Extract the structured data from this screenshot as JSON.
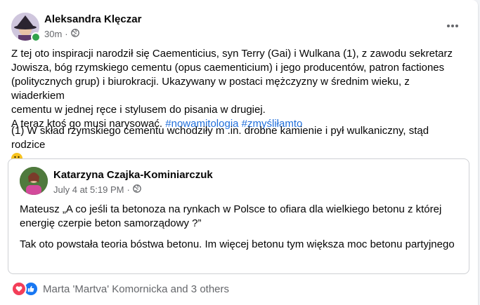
{
  "post": {
    "author": "Aleksandra Klęczar",
    "time": "30m",
    "dot": "·",
    "lines": [
      "Z tej oto inspiracji narodził się Caementicius, syn Terry (Gai) i Wulkana (1), z zawodu sekretarz",
      "Jowisza, bóg rzymskiego cementu (opus caementicium) i jego producentów, patron factiones",
      "(politycznych grup) i biurokracji. Ukazywany w postaci mężczyzny w średnim wieku, z wiaderkiem",
      "cementu w jednej ręce i stylusem do pisania w drugiej."
    ],
    "last_line": "A teraz ktoś go musi narysować.",
    "hashtags": [
      "#nowamitologia",
      "#zmyśliłamto"
    ],
    "footnote": "(1) W skład rzymskiego cementu wchodziły m .in. drobne kamienie i pył wulkaniczny, stąd rodzice"
  },
  "shared": {
    "author": "Katarzyna Czajka-Kominiarczuk",
    "time": "July 4 at 5:19 PM",
    "dot": "·",
    "paragraphs": [
      "Mateusz „A co jeśli ta betonoza na rynkach w Polsce to ofiara dla wielkiego betonu z której energię czerpie beton samorządowy ?”",
      "Tak oto powstała teoria bóstwa betonu. Im więcej betonu tym większa moc betonu partyjnego"
    ]
  },
  "reactions": {
    "summary": "Marta 'Martva' Komornicka and 3 others"
  },
  "colors": {
    "hashtag": "#216fdb",
    "online": "#31a24c",
    "love": "#f33e58",
    "like": "#1877f2"
  }
}
